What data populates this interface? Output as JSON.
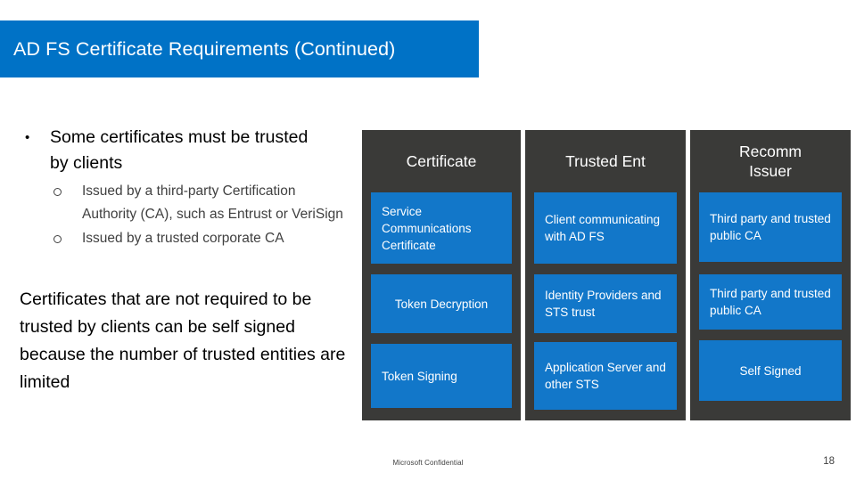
{
  "slide": {
    "title": "AD FS Certificate Requirements (Continued)",
    "title_bar_color": "#0072c6",
    "accent_blue": "#1277c9",
    "table_bg_color": "#3a3a38",
    "footer_note": "Microsoft Confidential",
    "page_number": "18"
  },
  "body": {
    "bullet": {
      "marker": "•",
      "text": "Some certificates must be trusted by clients"
    },
    "subbullets": [
      {
        "marker": "circle-outline",
        "text": "Issued by a third-party Certification Authority (CA), such as Entrust or VeriSign"
      },
      {
        "marker": "circle-outline",
        "text": "Issued by a trusted corporate CA"
      }
    ],
    "closing_paragraph": "Certificates that are not required to be trusted by clients can be self signed because the number of trusted entities are limited"
  },
  "table": {
    "headers": [
      {
        "line1": "Certificate",
        "line2": ""
      },
      {
        "line1": "Trusted Ent",
        "line2": ""
      },
      {
        "line1": "Recomm",
        "line2": "Issuer"
      }
    ],
    "rows": [
      {
        "certificate": "Service Communications Certificate",
        "trusted_ent": "Client communicating with AD FS",
        "recommended_issuer": "Third party and trusted public CA"
      },
      {
        "certificate": "Token Decryption",
        "trusted_ent": "Identity Providers and STS trust",
        "recommended_issuer": "Third party and trusted public CA"
      },
      {
        "certificate": "Token Signing",
        "trusted_ent": "Application Server and other STS",
        "recommended_issuer": "Self Signed"
      }
    ]
  }
}
